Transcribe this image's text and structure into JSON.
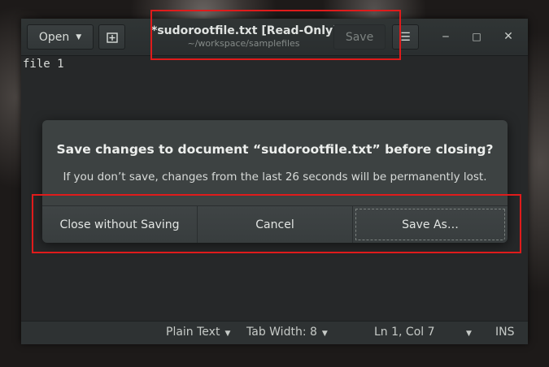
{
  "window": {
    "title": "*sudorootfile.txt [Read-Only]",
    "subtitle": "~/workspace/samplefiles"
  },
  "headerbar": {
    "open_label": "Open",
    "open_arrow": "▼",
    "save_label": "Save",
    "menu_glyph": "☰",
    "minimize_glyph": "‒",
    "maximize_glyph": "□",
    "close_glyph": "✕"
  },
  "editor": {
    "content": "file 1"
  },
  "dialog": {
    "title": "Save changes to document “sudorootfile.txt” before closing?",
    "message": "If you don’t save, changes from the last 26 seconds will be permanently lost.",
    "buttons": {
      "close_without_saving": "Close without Saving",
      "cancel": "Cancel",
      "save_as": "Save As…"
    }
  },
  "statusbar": {
    "language": "Plain Text",
    "tab_width": "Tab Width: 8",
    "position": "Ln 1, Col 7",
    "mode": "INS",
    "dropdown_arrow": "▼"
  },
  "colors": {
    "highlight": "#e01b1b",
    "window_bg": "#292c2d",
    "dialog_bg": "#3d4242"
  }
}
